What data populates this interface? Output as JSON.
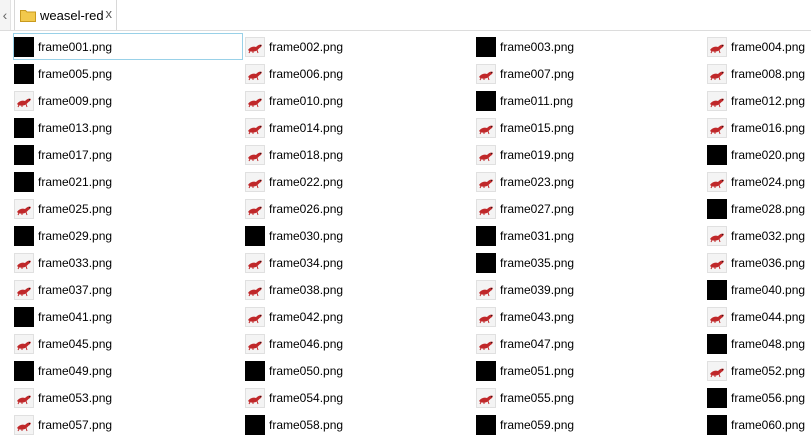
{
  "tab": {
    "label": "weasel-red",
    "close": "x"
  },
  "scroll_left_glyph": "‹",
  "files": [
    {
      "name": "frame001.png",
      "thumb": "black",
      "selected": true
    },
    {
      "name": "frame002.png",
      "thumb": "weasel"
    },
    {
      "name": "frame003.png",
      "thumb": "black"
    },
    {
      "name": "frame004.png",
      "thumb": "weasel"
    },
    {
      "name": "frame005.png",
      "thumb": "black"
    },
    {
      "name": "frame006.png",
      "thumb": "weasel"
    },
    {
      "name": "frame007.png",
      "thumb": "weasel"
    },
    {
      "name": "frame008.png",
      "thumb": "weasel"
    },
    {
      "name": "frame009.png",
      "thumb": "weasel"
    },
    {
      "name": "frame010.png",
      "thumb": "weasel"
    },
    {
      "name": "frame011.png",
      "thumb": "black"
    },
    {
      "name": "frame012.png",
      "thumb": "weasel"
    },
    {
      "name": "frame013.png",
      "thumb": "black"
    },
    {
      "name": "frame014.png",
      "thumb": "weasel"
    },
    {
      "name": "frame015.png",
      "thumb": "weasel"
    },
    {
      "name": "frame016.png",
      "thumb": "weasel"
    },
    {
      "name": "frame017.png",
      "thumb": "black"
    },
    {
      "name": "frame018.png",
      "thumb": "weasel"
    },
    {
      "name": "frame019.png",
      "thumb": "weasel"
    },
    {
      "name": "frame020.png",
      "thumb": "black"
    },
    {
      "name": "frame021.png",
      "thumb": "black"
    },
    {
      "name": "frame022.png",
      "thumb": "weasel"
    },
    {
      "name": "frame023.png",
      "thumb": "weasel"
    },
    {
      "name": "frame024.png",
      "thumb": "weasel"
    },
    {
      "name": "frame025.png",
      "thumb": "weasel"
    },
    {
      "name": "frame026.png",
      "thumb": "weasel"
    },
    {
      "name": "frame027.png",
      "thumb": "weasel"
    },
    {
      "name": "frame028.png",
      "thumb": "black"
    },
    {
      "name": "frame029.png",
      "thumb": "black"
    },
    {
      "name": "frame030.png",
      "thumb": "black"
    },
    {
      "name": "frame031.png",
      "thumb": "black"
    },
    {
      "name": "frame032.png",
      "thumb": "weasel"
    },
    {
      "name": "frame033.png",
      "thumb": "weasel"
    },
    {
      "name": "frame034.png",
      "thumb": "weasel"
    },
    {
      "name": "frame035.png",
      "thumb": "black"
    },
    {
      "name": "frame036.png",
      "thumb": "weasel"
    },
    {
      "name": "frame037.png",
      "thumb": "weasel"
    },
    {
      "name": "frame038.png",
      "thumb": "weasel"
    },
    {
      "name": "frame039.png",
      "thumb": "weasel"
    },
    {
      "name": "frame040.png",
      "thumb": "black"
    },
    {
      "name": "frame041.png",
      "thumb": "black"
    },
    {
      "name": "frame042.png",
      "thumb": "weasel"
    },
    {
      "name": "frame043.png",
      "thumb": "weasel"
    },
    {
      "name": "frame044.png",
      "thumb": "weasel"
    },
    {
      "name": "frame045.png",
      "thumb": "weasel"
    },
    {
      "name": "frame046.png",
      "thumb": "weasel"
    },
    {
      "name": "frame047.png",
      "thumb": "weasel"
    },
    {
      "name": "frame048.png",
      "thumb": "black"
    },
    {
      "name": "frame049.png",
      "thumb": "black"
    },
    {
      "name": "frame050.png",
      "thumb": "black"
    },
    {
      "name": "frame051.png",
      "thumb": "black"
    },
    {
      "name": "frame052.png",
      "thumb": "weasel"
    },
    {
      "name": "frame053.png",
      "thumb": "weasel"
    },
    {
      "name": "frame054.png",
      "thumb": "weasel"
    },
    {
      "name": "frame055.png",
      "thumb": "weasel"
    },
    {
      "name": "frame056.png",
      "thumb": "black"
    },
    {
      "name": "frame057.png",
      "thumb": "weasel"
    },
    {
      "name": "frame058.png",
      "thumb": "black"
    },
    {
      "name": "frame059.png",
      "thumb": "black"
    },
    {
      "name": "frame060.png",
      "thumb": "black"
    }
  ],
  "colors": {
    "weasel": "#c0282a",
    "selection": "#99d1e8",
    "folder": "#f2c94c"
  }
}
